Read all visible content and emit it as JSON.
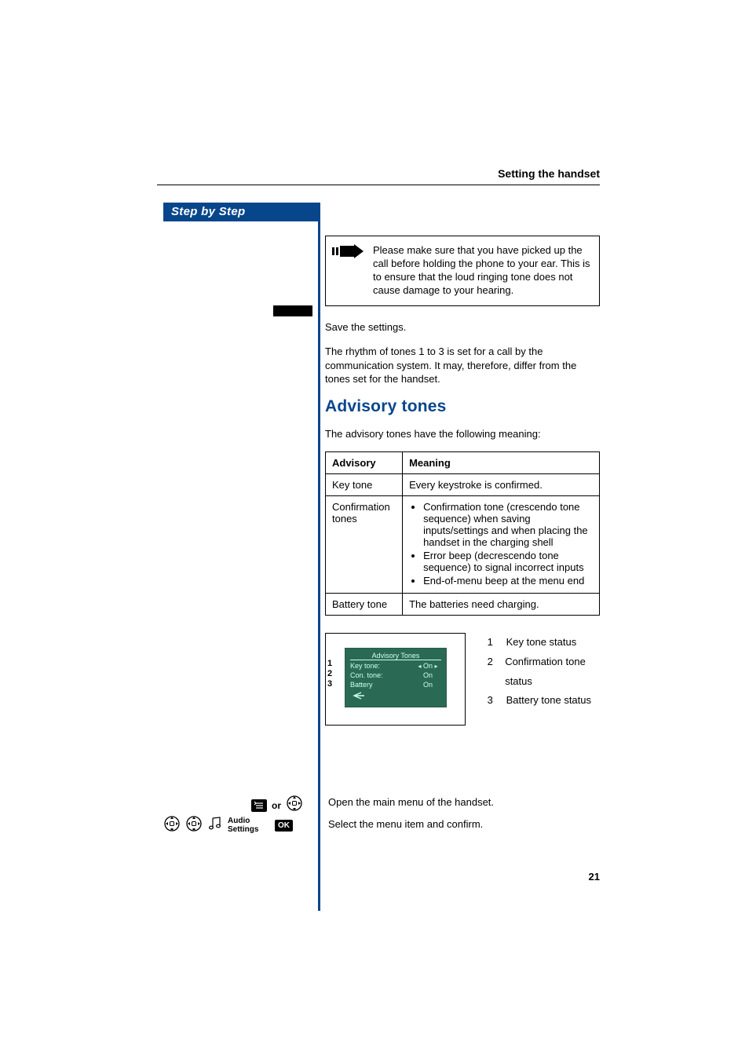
{
  "header_section": "Setting the handset",
  "sidebar_title": "Step by Step",
  "note_text": "Please make sure that you have picked up the call before holding the phone to your ear. This is to ensure that the loud ringing tone does not cause damage to your hearing.",
  "save_text": "Save the settings.",
  "rhythm_text": "The rhythm of tones 1 to 3 is set for a call by the communication system. It may, therefore, differ from the tones set for the handset.",
  "h2": "Advisory tones",
  "intro_text": "The advisory tones have the following meaning:",
  "table": {
    "headers": [
      "Advisory",
      "Meaning"
    ],
    "rows": [
      {
        "advisory": "Key tone",
        "meaning_text": "Every keystroke is confirmed."
      },
      {
        "advisory": "Confirmation tones",
        "bullets": [
          "Confirmation tone (crescendo tone sequence) when saving inputs/settings and when placing the handset in the charging shell",
          "Error beep (decrescendo tone sequence) to signal incorrect inputs",
          "End-of-menu beep at the menu end"
        ]
      },
      {
        "advisory": "Battery tone",
        "meaning_text": "The batteries need charging."
      }
    ]
  },
  "screen": {
    "title": "Advisory Tones",
    "rows": [
      {
        "label": "Key tone:",
        "value": "On",
        "arrows": true
      },
      {
        "label": "Con. tone:",
        "value": "On",
        "arrows": false
      },
      {
        "label": "Battery",
        "value": "On",
        "arrows": false
      }
    ]
  },
  "callouts": {
    "1": "1",
    "2": "2",
    "3": "3"
  },
  "legend": [
    {
      "n": "1",
      "t": "Key tone status"
    },
    {
      "n": "2",
      "t": "Confirmation tone status"
    },
    {
      "n": "3",
      "t": "Battery tone status"
    }
  ],
  "steps": {
    "or": "or",
    "menu_item": "Audio Settings",
    "ok": "OK",
    "text1": "Open the main menu of the handset.",
    "text2": "Select the menu item and confirm."
  },
  "page_number": "21"
}
